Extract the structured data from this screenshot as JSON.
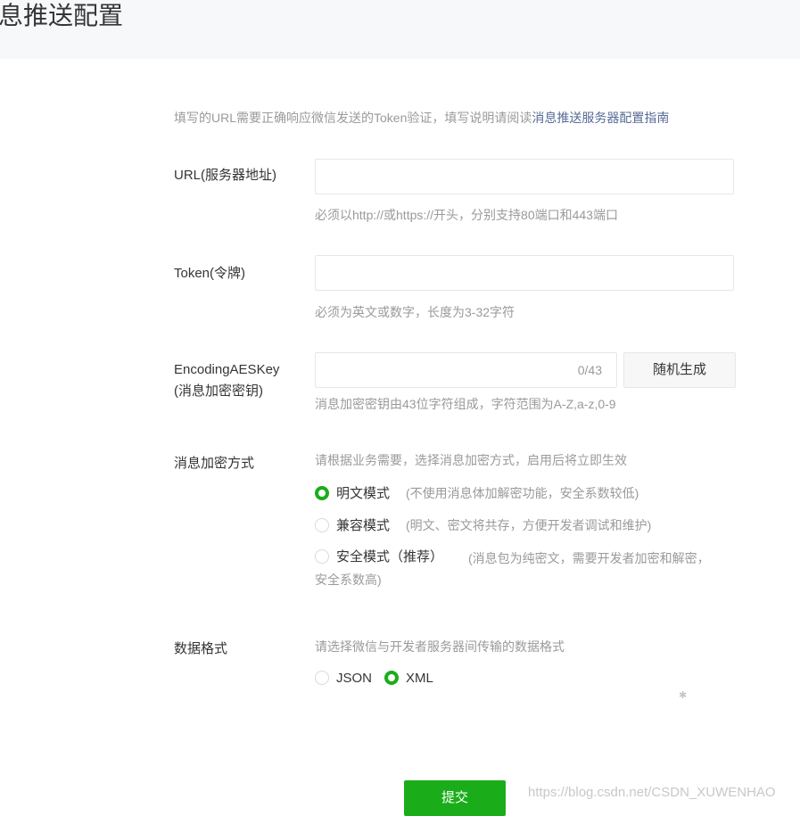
{
  "page": {
    "title": "息推送配置"
  },
  "intro": {
    "text": "填写的URL需要正确响应微信发送的Token验证，填写说明请阅读",
    "link": "消息推送服务器配置指南"
  },
  "fields": {
    "url": {
      "label": "URL(服务器地址)",
      "value": "",
      "tip": "必须以http://或https://开头，分别支持80端口和443端口"
    },
    "token": {
      "label": "Token(令牌)",
      "value": "",
      "tip": "必须为英文或数字，长度为3-32字符"
    },
    "aes": {
      "label_line1": "EncodingAESKey",
      "label_line2": "(消息加密密钥)",
      "value": "",
      "counter": "0/43",
      "generate_button": "随机生成",
      "tip": "消息加密密钥由43位字符组成，字符范围为A-Z,a-z,0-9"
    }
  },
  "encryption": {
    "label": "消息加密方式",
    "hint": "请根据业务需要，选择消息加密方式，启用后将立即生效",
    "selected": "明文模式",
    "options": [
      {
        "label": "明文模式",
        "desc": "(不使用消息体加解密功能，安全系数较低)"
      },
      {
        "label": "兼容模式",
        "desc": "(明文、密文将共存，方便开发者调试和维护)"
      },
      {
        "label": "安全模式（推荐）",
        "desc": "(消息包为纯密文，需要开发者加密和解密，安全系数高)"
      }
    ]
  },
  "data_format": {
    "label": "数据格式",
    "hint": "请选择微信与开发者服务器间传输的数据格式",
    "selected": "XML",
    "options": [
      "JSON",
      "XML"
    ]
  },
  "submit_label": "提交",
  "watermark": "https://blog.csdn.net/CSDN_XUWENHAO",
  "colors": {
    "accent": "#1aad19",
    "link": "#576b95",
    "muted": "#9a9a9a",
    "header_bg": "#f6f8f9"
  }
}
